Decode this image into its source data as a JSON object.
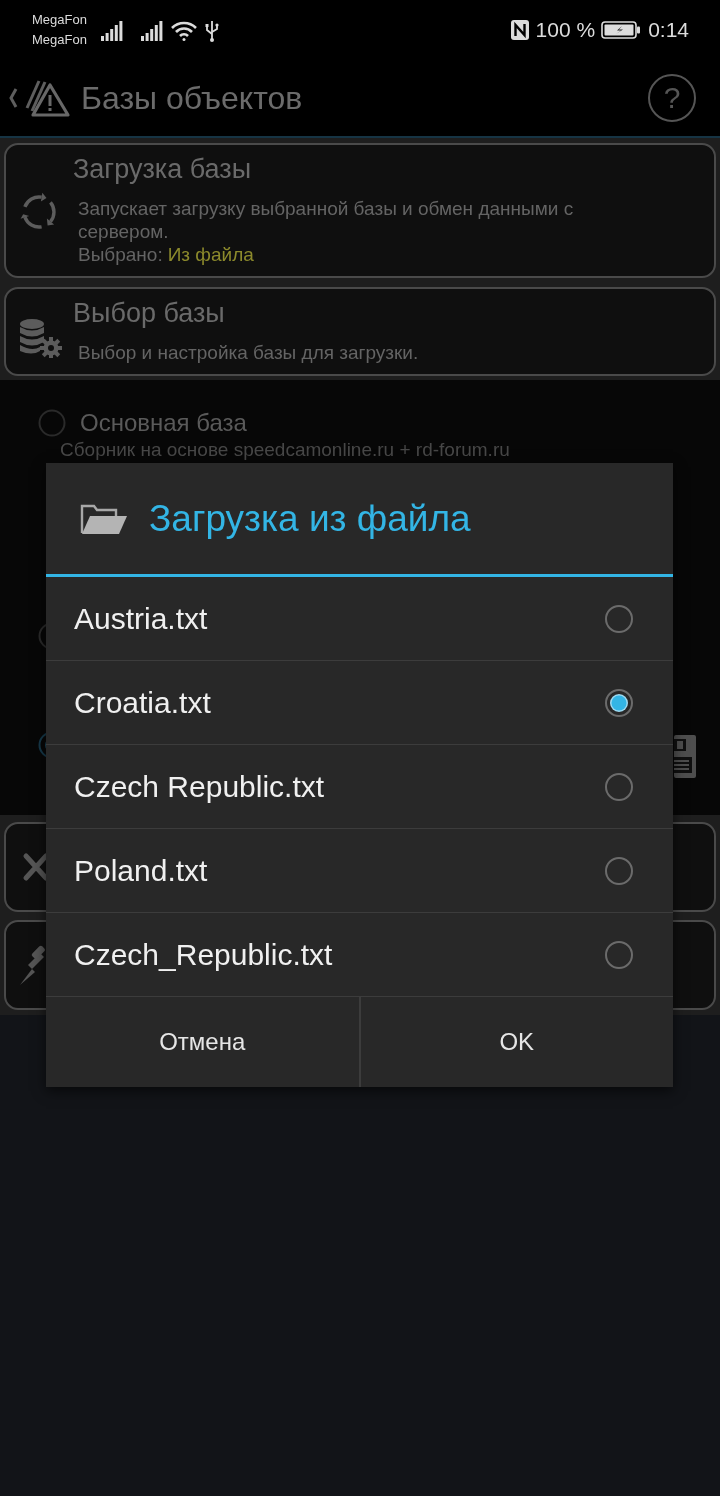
{
  "status_bar": {
    "carriers": [
      "MegaFon",
      "MegaFon"
    ],
    "battery_percent": "100 %",
    "time": "0:14"
  },
  "app_bar": {
    "title": "Базы объектов",
    "help_button": "?"
  },
  "cards": [
    {
      "kind": "download",
      "title": "Загрузка базы",
      "description": "Запускает загрузку выбранной базы и обмен данными с сервером.",
      "selected_label": "Выбрано:",
      "selected_value": "Из файла"
    },
    {
      "kind": "choose",
      "title": "Выбор базы",
      "description": "Выбор и настройка базы для загрузки."
    }
  ],
  "base_options": [
    {
      "label": "Основная база",
      "description": "Сборник на основе speedcamonline.ru + rd-forum.ru",
      "selected": false
    },
    {
      "selected": false
    },
    {
      "selected": true
    }
  ],
  "background_actions": [
    {
      "kind": "clear"
    },
    {
      "kind": "pin"
    }
  ],
  "dialog": {
    "title": "Загрузка из файла",
    "files": [
      {
        "name": "Austria.txt",
        "selected": false
      },
      {
        "name": "Croatia.txt",
        "selected": true
      },
      {
        "name": "Czech Republic.txt",
        "selected": false
      },
      {
        "name": "Poland.txt",
        "selected": false
      },
      {
        "name": "Czech_Republic.txt",
        "selected": false
      }
    ],
    "buttons": [
      "Отмена",
      "OK"
    ]
  }
}
